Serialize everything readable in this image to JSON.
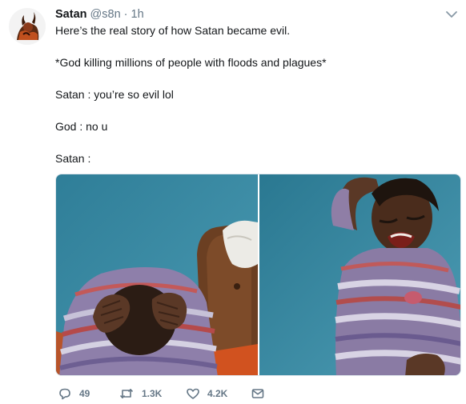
{
  "tweet": {
    "author_name": "Satan",
    "author_handle": "@s8n",
    "separator": "·",
    "time": "1h",
    "lines": [
      "Here’s the real story of how Satan became evil.",
      "*God killing millions of people with floods and plagues*",
      "Satan : you’re so evil lol",
      "God : no u",
      "Satan :"
    ]
  },
  "media": {
    "panels": [
      "child-holding-head-left",
      "child-crying-right"
    ]
  },
  "actions": {
    "reply_count": "49",
    "retweet_count": "1.3K",
    "like_count": "4.2K"
  },
  "icons": {
    "reply": "reply-icon",
    "retweet": "retweet-icon",
    "like": "heart-icon",
    "dm": "envelope-icon",
    "menu": "chevron-down-icon"
  },
  "colors": {
    "text": "#14171a",
    "secondary": "#657786",
    "border": "#e1e8ed"
  }
}
